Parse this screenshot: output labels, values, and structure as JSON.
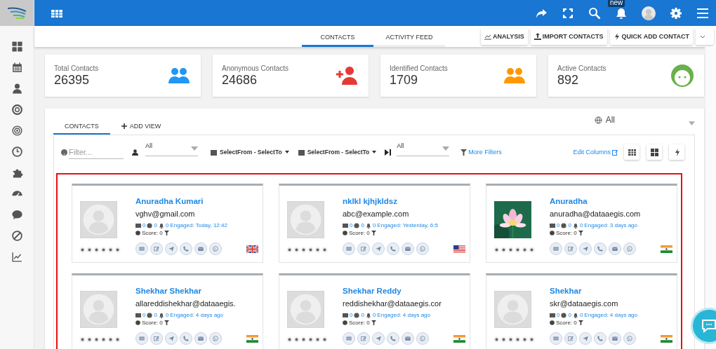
{
  "header": {
    "badge": "new"
  },
  "tabs": [
    {
      "label": "CONTACTS",
      "selected": true
    },
    {
      "label": "ACTIVITY FEED",
      "selected": false
    }
  ],
  "actions": [
    {
      "label": "ANALYSIS",
      "kind": "chart"
    },
    {
      "label": "IMPORT CONTACTS",
      "kind": "upload"
    },
    {
      "label": "QUICK ADD CONTACT",
      "kind": "bolt"
    }
  ],
  "stats": [
    {
      "label": "Total Contacts",
      "value": "26395",
      "kind": "group",
      "color": "#2196f3"
    },
    {
      "label": "Anonymous Contacts",
      "value": "24686",
      "kind": "add",
      "color": "#e53935"
    },
    {
      "label": "Identified Contacts",
      "value": "1709",
      "kind": "group",
      "color": "#ff9800"
    },
    {
      "label": "Active Contacts",
      "value": "892",
      "kind": "face",
      "color": "#6ab04c"
    }
  ],
  "view_tabs": [
    {
      "label": "CONTACTS",
      "selected": true,
      "kind": "tab"
    },
    {
      "label": "ADD VIEW",
      "selected": false,
      "kind": "add"
    }
  ],
  "scope": "All",
  "filters": {
    "placeholder": "Filter...",
    "owner": "All",
    "date_1": "SelectFrom - SelectTo",
    "date_2": "SelectFrom - SelectTo",
    "stage": "All",
    "more": "More Filters",
    "edit_columns": "Edit Columns"
  },
  "contacts": [
    {
      "name": "Anuradha Kumari",
      "email": "vghv@gmail.com",
      "emails": "0",
      "visits": "0",
      "alerts": "0",
      "engaged": "Engaged: Today, 12:42",
      "score": "Score: 0",
      "photo": false,
      "flag": {
        "kind": "gb"
      }
    },
    {
      "name": "nklkl kjhjkldsz",
      "email": "abc@example.com",
      "emails": "0",
      "visits": "0",
      "alerts": "0",
      "engaged": "Engaged: Yesterday, 6:5",
      "score": "Score: 0",
      "photo": false,
      "flag": {
        "kind": "us"
      }
    },
    {
      "name": "Anuradha",
      "email": "anuradha@dataaegis.com",
      "emails": "0",
      "visits": "0",
      "alerts": "0",
      "engaged": "Engaged: 3 days ago",
      "score": "Score: 0",
      "photo": true,
      "flag": {
        "kind": "in"
      }
    },
    {
      "name": "Shekhar Shekhar",
      "email": "allareddishekhar@dataaegis.",
      "emails": "0",
      "visits": "0",
      "alerts": "0",
      "engaged": "Engaged: 4 days ago",
      "score": "Score: 0",
      "photo": false,
      "flag": {
        "kind": "in"
      }
    },
    {
      "name": "Shekhar Reddy",
      "email": "reddishekhar@dataaegis.cor",
      "emails": "0",
      "visits": "0",
      "alerts": "0",
      "engaged": "Engaged: 4 days ago",
      "score": "Score: 0",
      "photo": false,
      "flag": {
        "kind": "in"
      }
    },
    {
      "name": "Shekhar",
      "email": "skr@dataaegis.com",
      "emails": "0",
      "visits": "0",
      "alerts": "0",
      "engaged": "Engaged: 4 days ago",
      "score": "Score: 0",
      "photo": false,
      "flag": {
        "kind": "in"
      }
    }
  ]
}
